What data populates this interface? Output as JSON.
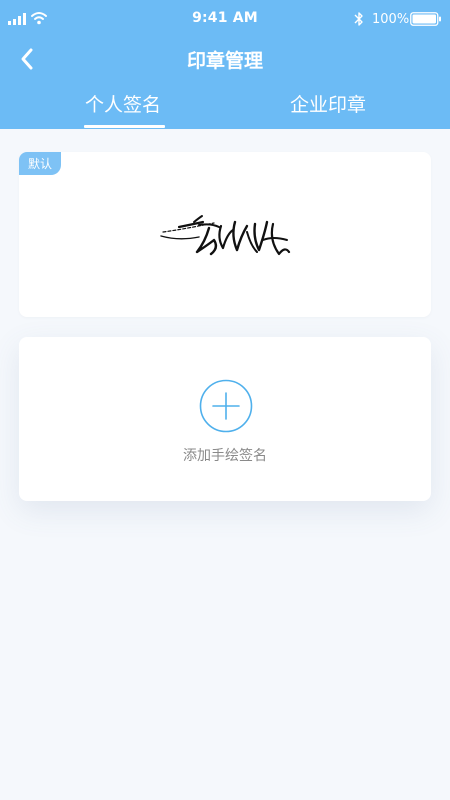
{
  "status_bar": {
    "time": "9:41 AM",
    "battery_text": "100%",
    "icons": [
      "signal-icon",
      "wifi-icon",
      "bluetooth-icon",
      "battery-icon"
    ]
  },
  "nav": {
    "title": "印章管理",
    "back_icon": "chevron-left-icon"
  },
  "tabs": [
    {
      "label": "个人签名",
      "active": true
    },
    {
      "label": "企业印章",
      "active": false
    }
  ],
  "signature_card": {
    "badge": "默认"
  },
  "add_card": {
    "icon": "plus-circle-icon",
    "label": "添加手绘签名"
  },
  "colors": {
    "header_bg": "#6cbbf5",
    "page_bg": "#f5f8fc",
    "badge_bg": "#7ec2f5",
    "accent": "#4fb0ec",
    "label_gray": "#8a8a8a"
  }
}
